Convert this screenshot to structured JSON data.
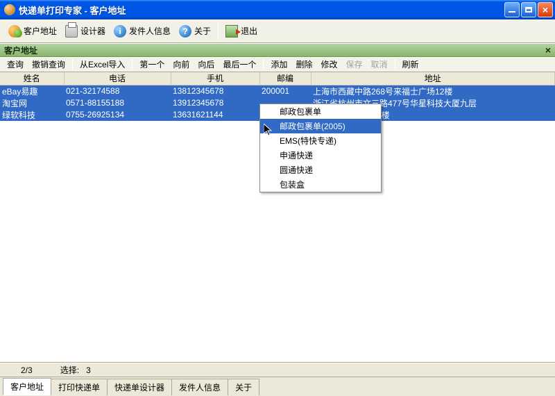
{
  "titlebar": {
    "text": "快递单打印专家 - 客户地址"
  },
  "maintoolbar": {
    "customer": "客户地址",
    "designer": "设计器",
    "sender": "发件人信息",
    "about": "关于",
    "exit": "退出"
  },
  "panel": {
    "title": "客户地址"
  },
  "subtoolbar": {
    "query": "查询",
    "undo_query": "撤销查询",
    "import_excel": "从Excel导入",
    "first": "第一个",
    "prev": "向前",
    "next": "向后",
    "last": "最后一个",
    "add": "添加",
    "delete": "删除",
    "edit": "修改",
    "save": "保存",
    "cancel": "取消",
    "refresh": "刷新"
  },
  "columns": {
    "name": "姓名",
    "phone": "电话",
    "mobile": "手机",
    "zip": "邮编",
    "address": "地址"
  },
  "rows": [
    {
      "name": "eBay易趣",
      "phone": "021-32174588",
      "mobile": "13812345678",
      "zip": "200001",
      "address": "上海市西藏中路268号来福士广场12楼"
    },
    {
      "name": "淘宝网",
      "phone": "0571-88155188",
      "mobile": "13912345678",
      "zip": "",
      "address": "浙江省杭州市文三路477号华星科技大厦九层"
    },
    {
      "name": "绿软科技",
      "phone": "0755-26925134",
      "mobile": "13631621144",
      "zip": "",
      "address": "田区田面花园B栋5楼"
    }
  ],
  "context_menu": {
    "items": [
      "邮政包裹单",
      "邮政包裹单(2005)",
      "EMS(特快专递)",
      "申通快递",
      "圆通快递",
      "包装盒"
    ],
    "hover_index": 1
  },
  "status": {
    "page": "2/3",
    "selection_label": "选择:",
    "selection_count": "3"
  },
  "tabs": {
    "items": [
      "客户地址",
      "打印快递单",
      "快递单设计器",
      "发件人信息",
      "关于"
    ],
    "active_index": 0
  }
}
